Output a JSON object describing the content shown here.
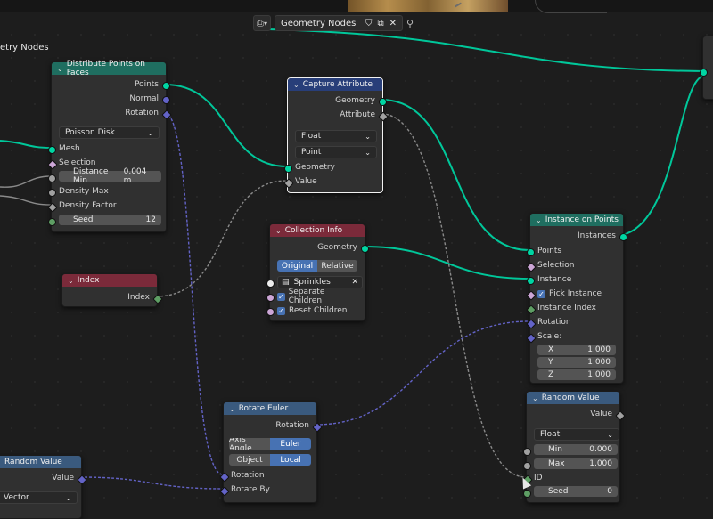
{
  "header": {
    "tree_name": "Geometry Nodes",
    "left_label": "etry Nodes",
    "icons": [
      "editor-type-icon",
      "shield-icon",
      "copy-icon",
      "close-icon",
      "pin-icon"
    ]
  },
  "colors": {
    "geometry_socket": "#00d6a3",
    "vector_socket": "#6363c7",
    "float_socket": "#a1a1a1",
    "int_socket": "#5e9e64",
    "geometry_header": "#1f6e60",
    "utility_header": "#283e79",
    "input_header": "#7b2a3a",
    "selected_accent": "#4772b3"
  },
  "nodes": {
    "distribute": {
      "title": "Distribute Points on Faces",
      "outputs": [
        "Points",
        "Normal",
        "Rotation"
      ],
      "method": "Poisson Disk",
      "inputs": {
        "mesh": "Mesh",
        "selection": "Selection",
        "distance_label": "Distance Min",
        "distance_value": "0.004 m",
        "density_max": "Density Max",
        "density_factor": "Density Factor",
        "seed_label": "Seed",
        "seed_value": "12"
      }
    },
    "capture": {
      "title": "Capture Attribute",
      "outputs": [
        "Geometry",
        "Attribute"
      ],
      "type": "Float",
      "domain": "Point",
      "inputs": [
        "Geometry",
        "Value"
      ]
    },
    "index": {
      "title": "Index",
      "output": "Index"
    },
    "collection": {
      "title": "Collection Info",
      "output": "Geometry",
      "mode_original": "Original",
      "mode_relative": "Relative",
      "collection": "Sprinkles",
      "separate": "Separate Children",
      "reset": "Reset Children"
    },
    "instance": {
      "title": "Instance on Points",
      "output": "Instances",
      "inputs": {
        "points": "Points",
        "selection": "Selection",
        "instance": "Instance",
        "pick": "Pick Instance",
        "index": "Instance Index",
        "rotation": "Rotation",
        "scale": "Scale:"
      },
      "scale": [
        {
          "axis": "X",
          "value": "1.000"
        },
        {
          "axis": "Y",
          "value": "1.000"
        },
        {
          "axis": "Z",
          "value": "1.000"
        }
      ]
    },
    "random_right": {
      "title": "Random Value",
      "output": "Value",
      "type": "Float",
      "min_label": "Min",
      "min_value": "0.000",
      "max_label": "Max",
      "max_value": "1.000",
      "id": "ID",
      "seed_label": "Seed",
      "seed_value": "0"
    },
    "rotate": {
      "title": "Rotate Euler",
      "output": "Rotation",
      "axis_angle": "Axis Angle",
      "euler": "Euler",
      "object": "Object",
      "local": "Local",
      "inputs": [
        "Rotation",
        "Rotate By"
      ]
    },
    "random_left": {
      "title": "Random Value",
      "output": "Value",
      "type": "Vector"
    }
  }
}
